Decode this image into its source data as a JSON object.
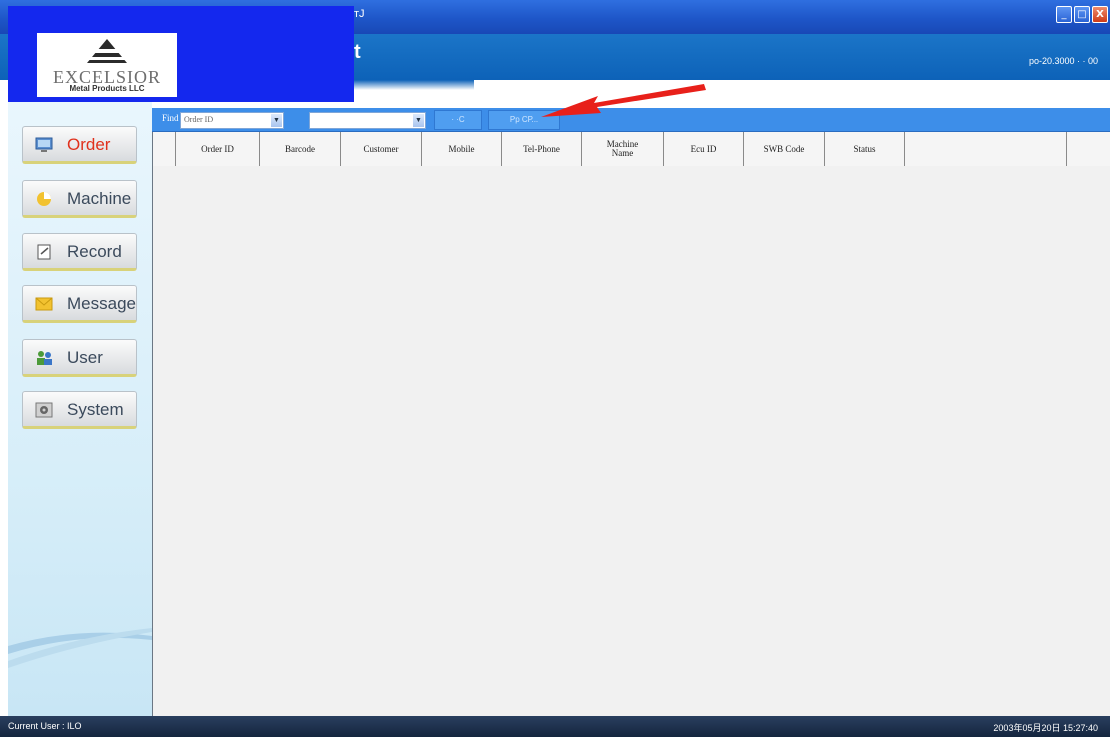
{
  "window": {
    "title": "тJ",
    "minimize_label": "_",
    "maximize_label": "□",
    "close_label": "X"
  },
  "header": {
    "app_title": "t",
    "info_text": "ро-20.3000 · · 00"
  },
  "logo": {
    "word": "EXCELSIOR",
    "subtitle": "Metal Products LLC",
    "accent_color": "#1428ee"
  },
  "sidebar": {
    "items": [
      {
        "label": "Order",
        "icon": "monitor-icon",
        "active": true
      },
      {
        "label": "Machine",
        "icon": "pie-chart-icon",
        "active": false
      },
      {
        "label": "Record",
        "icon": "document-icon",
        "active": false
      },
      {
        "label": "Message",
        "icon": "envelope-icon",
        "active": false
      },
      {
        "label": "User",
        "icon": "users-icon",
        "active": false
      },
      {
        "label": "System",
        "icon": "gear-icon",
        "active": false
      }
    ]
  },
  "toolbar": {
    "find_label": "Find",
    "field_select": "Order ID",
    "value_select": "",
    "button1_label": "· ·C",
    "button2_label": "Рр СР..."
  },
  "table": {
    "columns": [
      "Order ID",
      "Barcode",
      "Customer",
      "Mobile",
      "Tel-Phone",
      "Machine Name",
      "Ecu ID",
      "SWB Code",
      "Status"
    ]
  },
  "statusbar": {
    "left_text": "Current User : ILO",
    "right_text": "2003年05月20日 15:27:40"
  },
  "colors": {
    "titlebar": "#1e56c8",
    "header": "#0d62b8",
    "toolbar": "#3d8ee9",
    "active_label": "#e0311c",
    "annotation_arrow": "#e8201a"
  }
}
